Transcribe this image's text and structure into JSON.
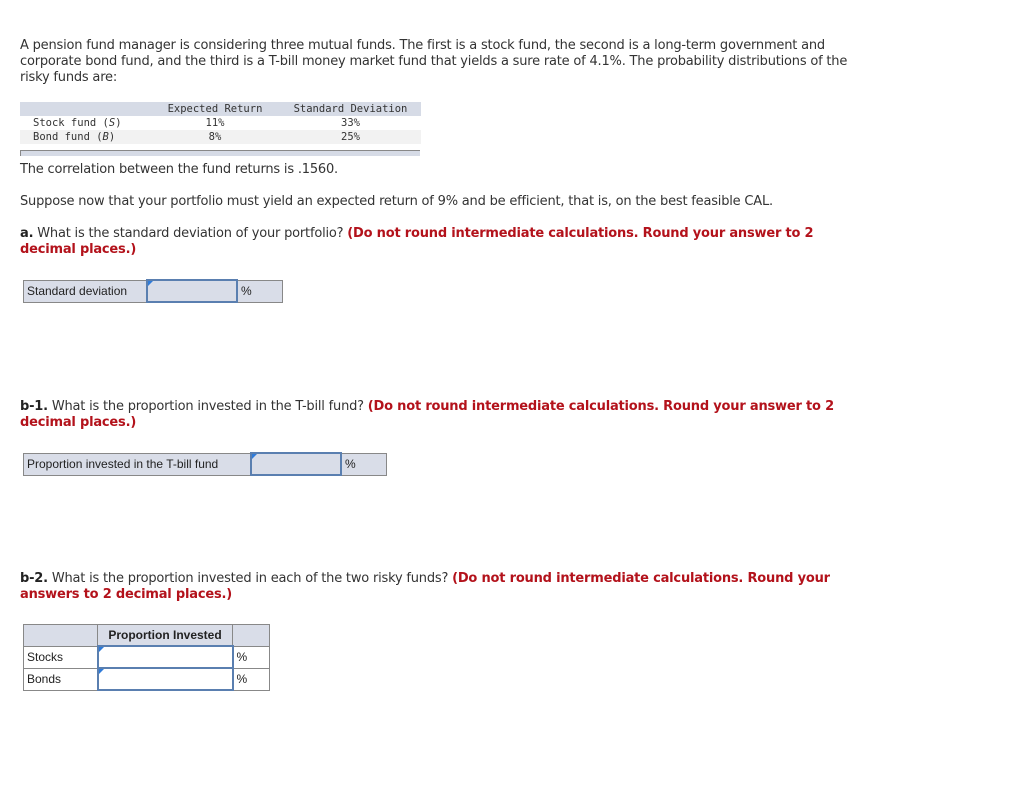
{
  "intro": "A pension fund manager is considering three mutual funds. The first is a stock fund, the second is a long-term government and corporate bond fund, and the third is a T-bill money market fund that yields a sure rate of 4.1%. The probability distributions of the risky funds are:",
  "fund_table": {
    "headers": [
      "",
      "Expected Return",
      "Standard Deviation"
    ],
    "rows": [
      {
        "name": "Stock fund (",
        "symbol": "S",
        "name_end": ")",
        "expected_return": "11%",
        "std_dev": "33%"
      },
      {
        "name": "Bond fund (",
        "symbol": "B",
        "name_end": ")",
        "expected_return": "8%",
        "std_dev": "25%"
      }
    ]
  },
  "correlation_text": "The correlation between the fund returns is .1560.",
  "suppose_text": "Suppose now that your portfolio must yield an expected return of 9% and be efficient, that is, on the best feasible CAL.",
  "question_a": {
    "label": "a.",
    "text": " What is the standard deviation of your portfolio? ",
    "instruction": "(Do not round intermediate calculations. Round your answer to 2 decimal places.)",
    "row_label": "Standard deviation",
    "value": "",
    "unit": "%"
  },
  "question_b1": {
    "label": "b-1.",
    "text": " What is the proportion invested in the T-bill fund? ",
    "instruction": "(Do not round intermediate calculations. Round your answer to 2 decimal places.)",
    "row_label": "Proportion invested in the T-bill fund",
    "value": "",
    "unit": "%"
  },
  "question_b2": {
    "label": "b-2.",
    "text": " What is the proportion invested in each of the two risky funds? ",
    "instruction": "(Do not round intermediate calculations. Round your answers to 2 decimal places.)",
    "column_header": "Proportion Invested",
    "rows": [
      {
        "label": "Stocks",
        "value": "",
        "unit": "%"
      },
      {
        "label": "Bonds",
        "value": "",
        "unit": "%"
      }
    ]
  }
}
